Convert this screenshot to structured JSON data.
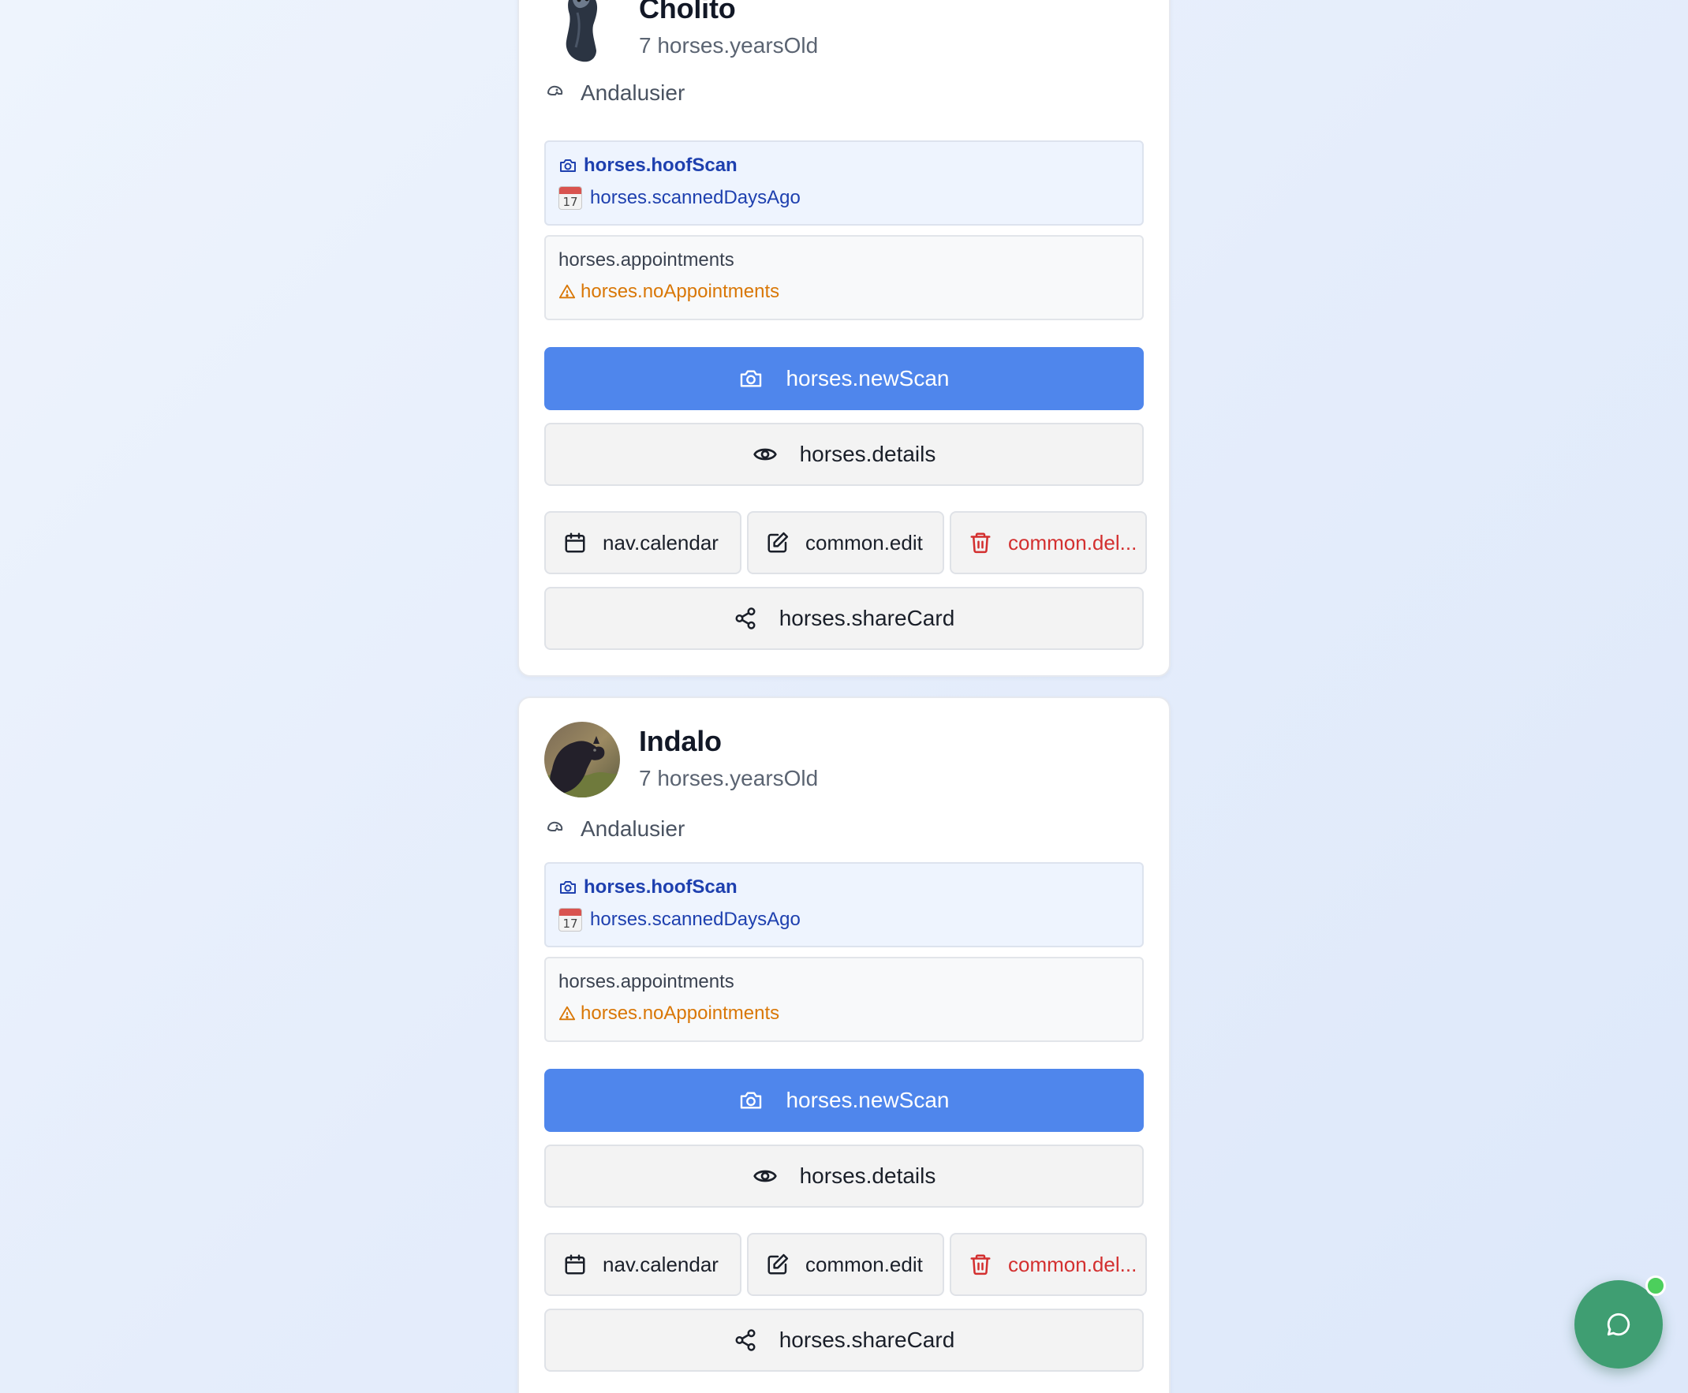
{
  "horses": [
    {
      "name": "Cholito",
      "age": "7 horses.yearsOld",
      "breed": "Andalusier",
      "scan": {
        "title": "horses.hoofScan",
        "date": "horses.scannedDaysAgo",
        "calendar_day": "17"
      },
      "appointments": {
        "title": "horses.appointments",
        "warning": "horses.noAppointments"
      },
      "actions": {
        "new_scan": "horses.newScan",
        "details": "horses.details",
        "calendar": "nav.calendar",
        "edit": "common.edit",
        "delete": "common.del...",
        "share": "horses.shareCard"
      }
    },
    {
      "name": "Indalo",
      "age": "7 horses.yearsOld",
      "breed": "Andalusier",
      "scan": {
        "title": "horses.hoofScan",
        "date": "horses.scannedDaysAgo",
        "calendar_day": "17"
      },
      "appointments": {
        "title": "horses.appointments",
        "warning": "horses.noAppointments"
      },
      "actions": {
        "new_scan": "horses.newScan",
        "details": "horses.details",
        "calendar": "nav.calendar",
        "edit": "common.edit",
        "delete": "common.del...",
        "share": "horses.shareCard"
      }
    }
  ],
  "colors": {
    "primary": "#4f86ec",
    "scan_text": "#1e40af",
    "warning": "#d97706",
    "danger": "#d32f2f",
    "chat": "#3f9e72",
    "online": "#4ccf5c"
  },
  "icons": {
    "breed": "horse-head-icon",
    "scan": "camera-icon",
    "date": "calendar-emoji-icon",
    "warning": "warning-triangle-icon",
    "new_scan": "camera-icon",
    "details": "eye-icon",
    "calendar": "calendar-icon",
    "edit": "edit-icon",
    "delete": "trash-icon",
    "share": "share-icon",
    "chat": "chat-bubble-icon"
  }
}
